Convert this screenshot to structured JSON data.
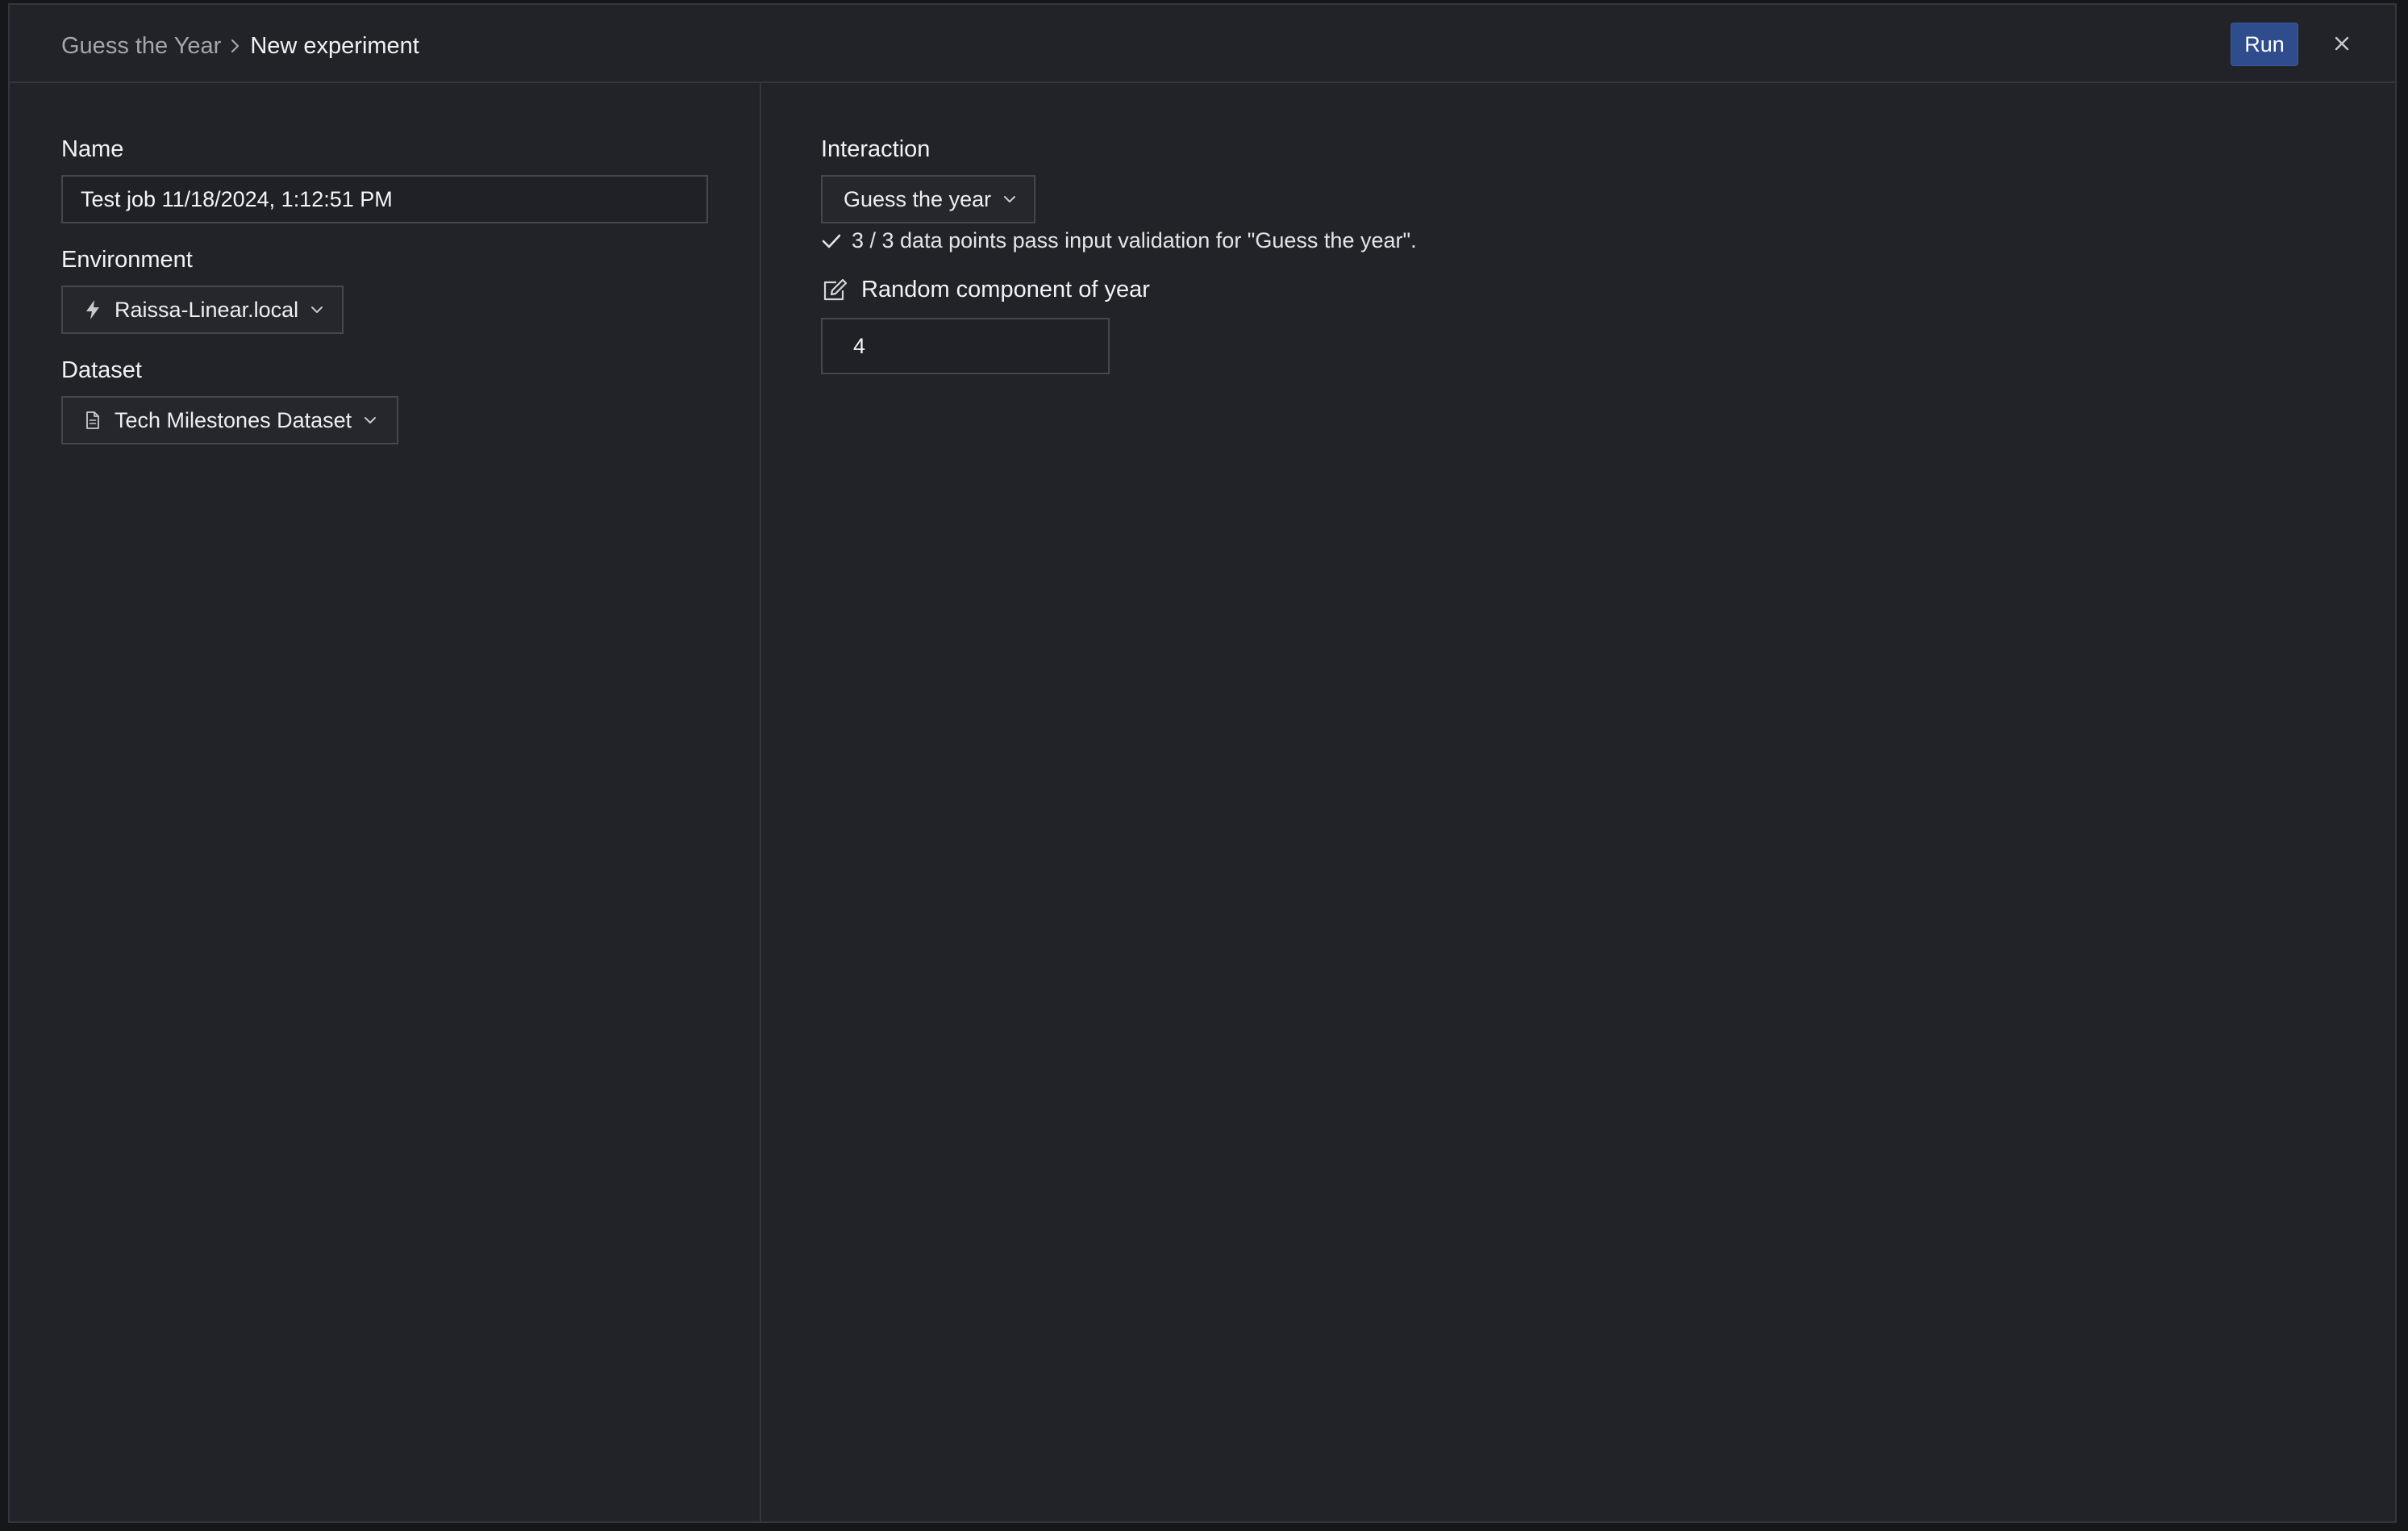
{
  "header": {
    "breadcrumb_parent": "Guess the Year",
    "breadcrumb_current": "New experiment",
    "run_label": "Run"
  },
  "form": {
    "name_label": "Name",
    "name_value": "Test job 11/18/2024, 1:12:51 PM",
    "environment_label": "Environment",
    "environment_value": "Raissa-Linear.local",
    "dataset_label": "Dataset",
    "dataset_value": "Tech Milestones Dataset"
  },
  "interaction": {
    "label": "Interaction",
    "selected": "Guess the year",
    "validation_message": "3 / 3 data points pass input validation for \"Guess the year\".",
    "parameter_label": "Random component of year",
    "parameter_value": "4"
  },
  "icons": {
    "breadcrumb_separator": "chevron-right-icon",
    "close": "close-icon",
    "environment": "lightning-icon",
    "dataset": "document-icon",
    "dropdown": "chevron-down-icon",
    "validation": "check-icon",
    "parameter": "edit-icon"
  },
  "colors": {
    "background": "#222328",
    "border": "#34363d",
    "accent": "#2f4c8c"
  }
}
